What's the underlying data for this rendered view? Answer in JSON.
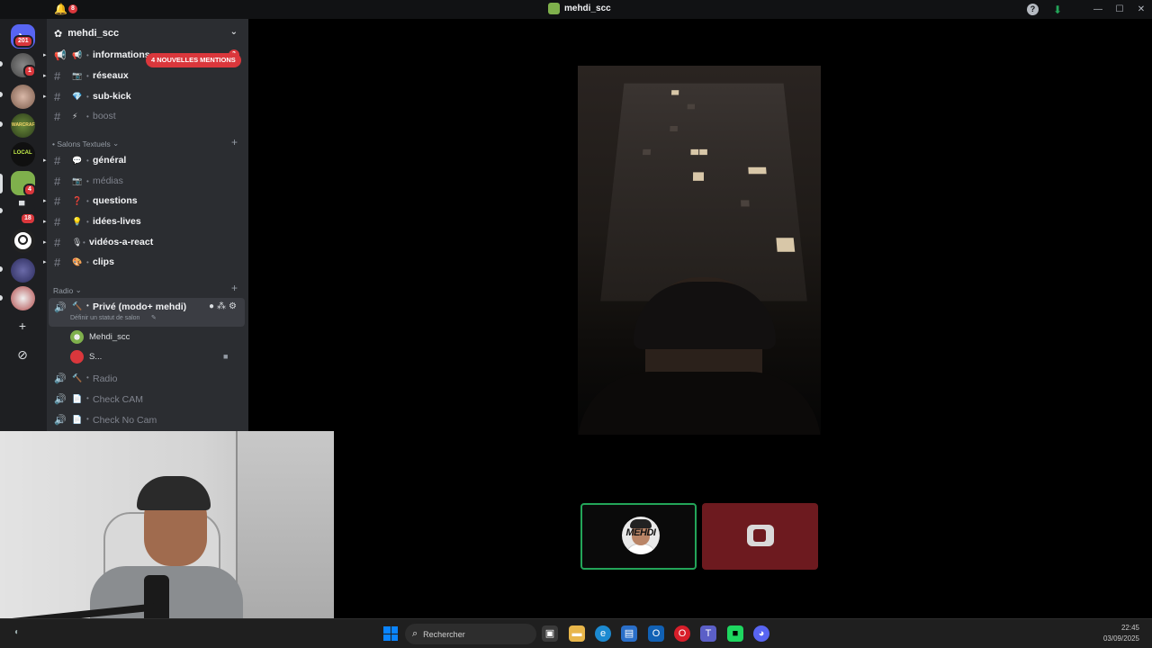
{
  "titlebar": {
    "title": "mehdi_scc",
    "notif_count": "8",
    "bell_icon": "bell-icon",
    "help_icon": "help-icon",
    "download_icon": "download-icon",
    "window_controls": [
      "—",
      "☐",
      "✕"
    ]
  },
  "rail": {
    "home_badge": "201",
    "badges": [
      "1",
      "4",
      "18"
    ]
  },
  "server": {
    "name": "mehdi_scc",
    "mention_pill": "4 NOUVELLES MENTIONS"
  },
  "channels_top": [
    {
      "name": "informations",
      "emoji": "📢",
      "state": "unread",
      "count": "3"
    },
    {
      "name": "réseaux",
      "emoji": "📷",
      "state": "unread"
    },
    {
      "name": "sub-kick",
      "emoji": "💎",
      "state": "unread"
    },
    {
      "name": "boost",
      "emoji": "⚡",
      "state": "read"
    }
  ],
  "categories": {
    "text": "Salons Textuels",
    "radio": "Radio"
  },
  "text_channels": [
    {
      "name": "général",
      "emoji": "💬",
      "state": "unread"
    },
    {
      "name": "médias",
      "emoji": "📷",
      "state": "read"
    },
    {
      "name": "questions",
      "emoji": "❓",
      "state": "unread"
    },
    {
      "name": "idées-lives",
      "emoji": "💡",
      "state": "unread"
    },
    {
      "name": "vidéos-a-react",
      "emoji": "🎙",
      "state": "unread"
    },
    {
      "name": "clips",
      "emoji": "🎨",
      "state": "unread"
    }
  ],
  "voice": {
    "active": {
      "name": "Privé (modo+ mehdi)",
      "status": "Définir un statut de salon"
    },
    "users": [
      {
        "name": "Mehdi_scc"
      },
      {
        "name": "S..."
      }
    ],
    "others": [
      {
        "name": "Radio",
        "emoji": "🔨"
      },
      {
        "name": "Check CAM",
        "emoji": "📄"
      },
      {
        "name": "Check No Cam",
        "emoji": "📄"
      }
    ]
  },
  "stage": {
    "tile_user_label": "MEHDI"
  },
  "taskbar": {
    "search_placeholder": "Rechercher",
    "time": "22:45",
    "date": "03/09/2025"
  }
}
